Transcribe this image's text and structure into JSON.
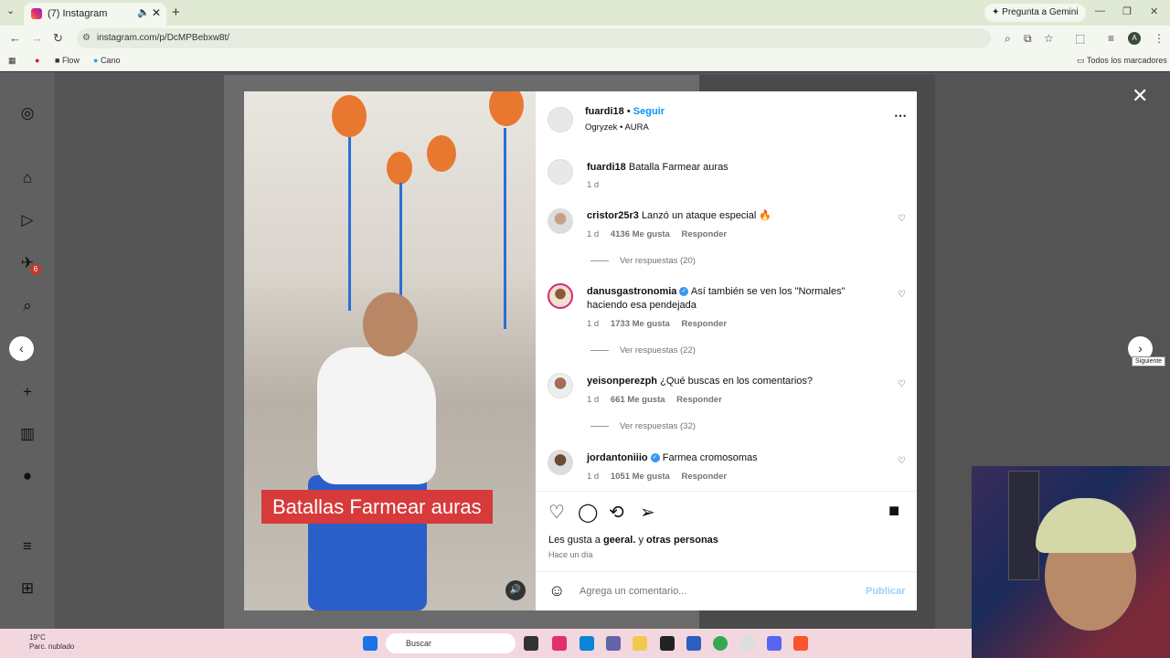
{
  "browser": {
    "tab_title": "(7) Instagram",
    "tab_audio_icon": "speaker-icon",
    "gemini_label": "Pregunta a Gemini",
    "url": "instagram.com/p/DcMPBebxw8t/",
    "bookmarks": [
      "Flow",
      "Cano"
    ],
    "bookmarks_all": "Todos los marcadores"
  },
  "sidebar": {
    "notifications_badge": "6"
  },
  "post": {
    "caption_overlay": "Batallas Farmear auras",
    "author": "fuardi18",
    "follow_label": "Seguir",
    "audio": "Ogryzek • AURA",
    "description_user": "fuardi18",
    "description_text": "Batalla Farmear auras",
    "description_time": "1 d"
  },
  "comments": [
    {
      "user": "cristor25r3",
      "verified": false,
      "text": "Lanzó un ataque especial 🔥",
      "time": "1 d",
      "likes": "4136 Me gusta",
      "reply": "Responder",
      "replies": "Ver respuestas (20)"
    },
    {
      "user": "danusgastronomia",
      "verified": true,
      "text": "Así también se ven los \"Normales\" haciendo esa pendejada",
      "time": "1 d",
      "likes": "1733 Me gusta",
      "reply": "Responder",
      "replies": "Ver respuestas (22)"
    },
    {
      "user": "yeisonperezph",
      "verified": false,
      "text": "¿Qué buscas en los comentarios?",
      "time": "1 d",
      "likes": "661 Me gusta",
      "reply": "Responder",
      "replies": "Ver respuestas (32)"
    },
    {
      "user": "jordantoniiio",
      "verified": true,
      "text": "Farmea cromosomas",
      "time": "1 d",
      "likes": "1051 Me gusta",
      "reply": "Responder",
      "replies": ""
    }
  ],
  "likes": {
    "prefix": "Les gusta a ",
    "user": "geeral.",
    "suffix": " y ",
    "others": "otras personas",
    "time": "Hace un día"
  },
  "add_comment": {
    "placeholder": "Agrega un comentario...",
    "publish": "Publicar"
  },
  "tooltip": "Siguiente",
  "taskbar": {
    "temp": "19°C",
    "weather": "Parc. nublado",
    "search": "Buscar"
  }
}
